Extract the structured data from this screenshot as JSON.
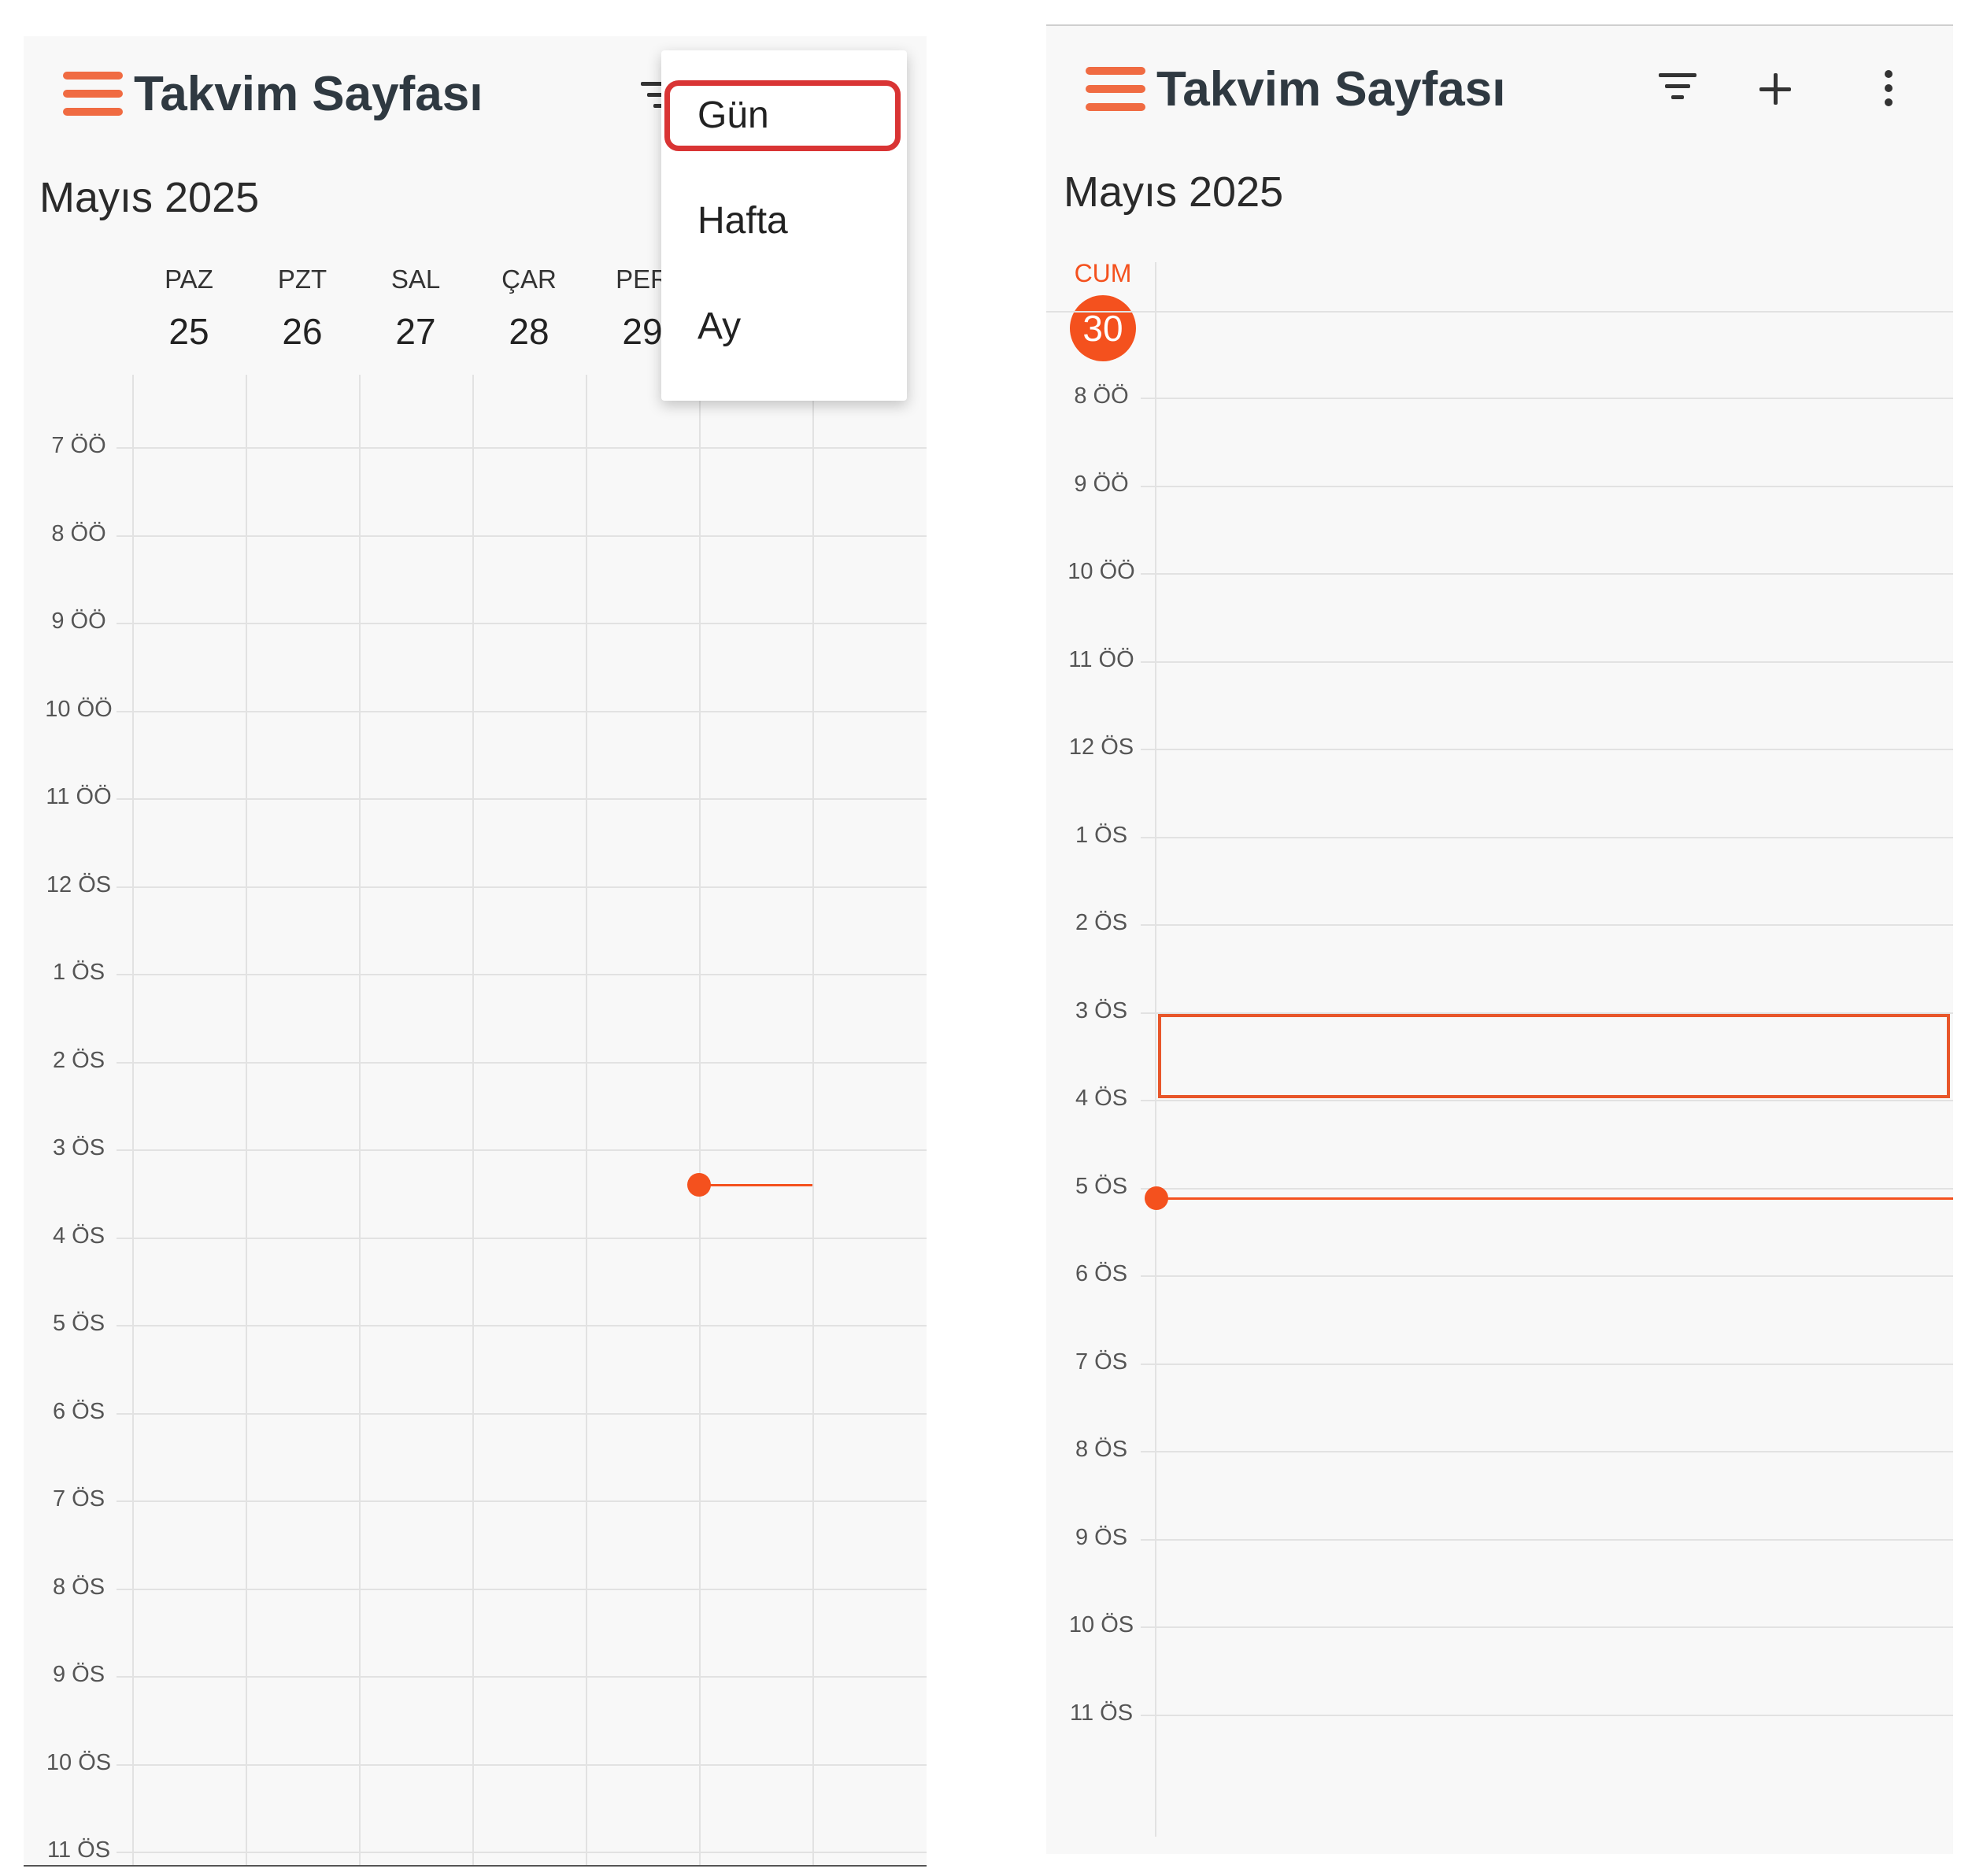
{
  "app_title": "Takvim Sayfası",
  "month_label": "Mayıs 2025",
  "accent_color": "#f4511e",
  "icons": {
    "menu": "hamburger-menu-icon",
    "filter": "filter-icon",
    "add": "plus-icon",
    "more": "more-vertical-icon"
  },
  "week_view": {
    "days": [
      {
        "name": "PAZ",
        "date": "25"
      },
      {
        "name": "PZT",
        "date": "26"
      },
      {
        "name": "SAL",
        "date": "27"
      },
      {
        "name": "ÇAR",
        "date": "28"
      },
      {
        "name": "PER",
        "date": "29"
      }
    ],
    "hours": [
      "7 ÖÖ",
      "8 ÖÖ",
      "9 ÖÖ",
      "10 ÖÖ",
      "11 ÖÖ",
      "12 ÖS",
      "1 ÖS",
      "2 ÖS",
      "3 ÖS",
      "4 ÖS",
      "5 ÖS",
      "6 ÖS",
      "7 ÖS",
      "8 ÖS",
      "9 ÖS",
      "10 ÖS",
      "11 ÖS"
    ]
  },
  "view_menu": {
    "items": [
      "Gün",
      "Hafta",
      "Ay"
    ],
    "highlighted": "Gün"
  },
  "day_view": {
    "day_name": "CUM",
    "day_date": "30",
    "hours": [
      "8 ÖÖ",
      "9 ÖÖ",
      "10 ÖÖ",
      "11 ÖÖ",
      "12 ÖS",
      "1 ÖS",
      "2 ÖS",
      "3 ÖS",
      "4 ÖS",
      "5 ÖS",
      "6 ÖS",
      "7 ÖS",
      "8 ÖS",
      "9 ÖS",
      "10 ÖS",
      "11 ÖS"
    ],
    "selected_slot": "3 ÖS"
  }
}
